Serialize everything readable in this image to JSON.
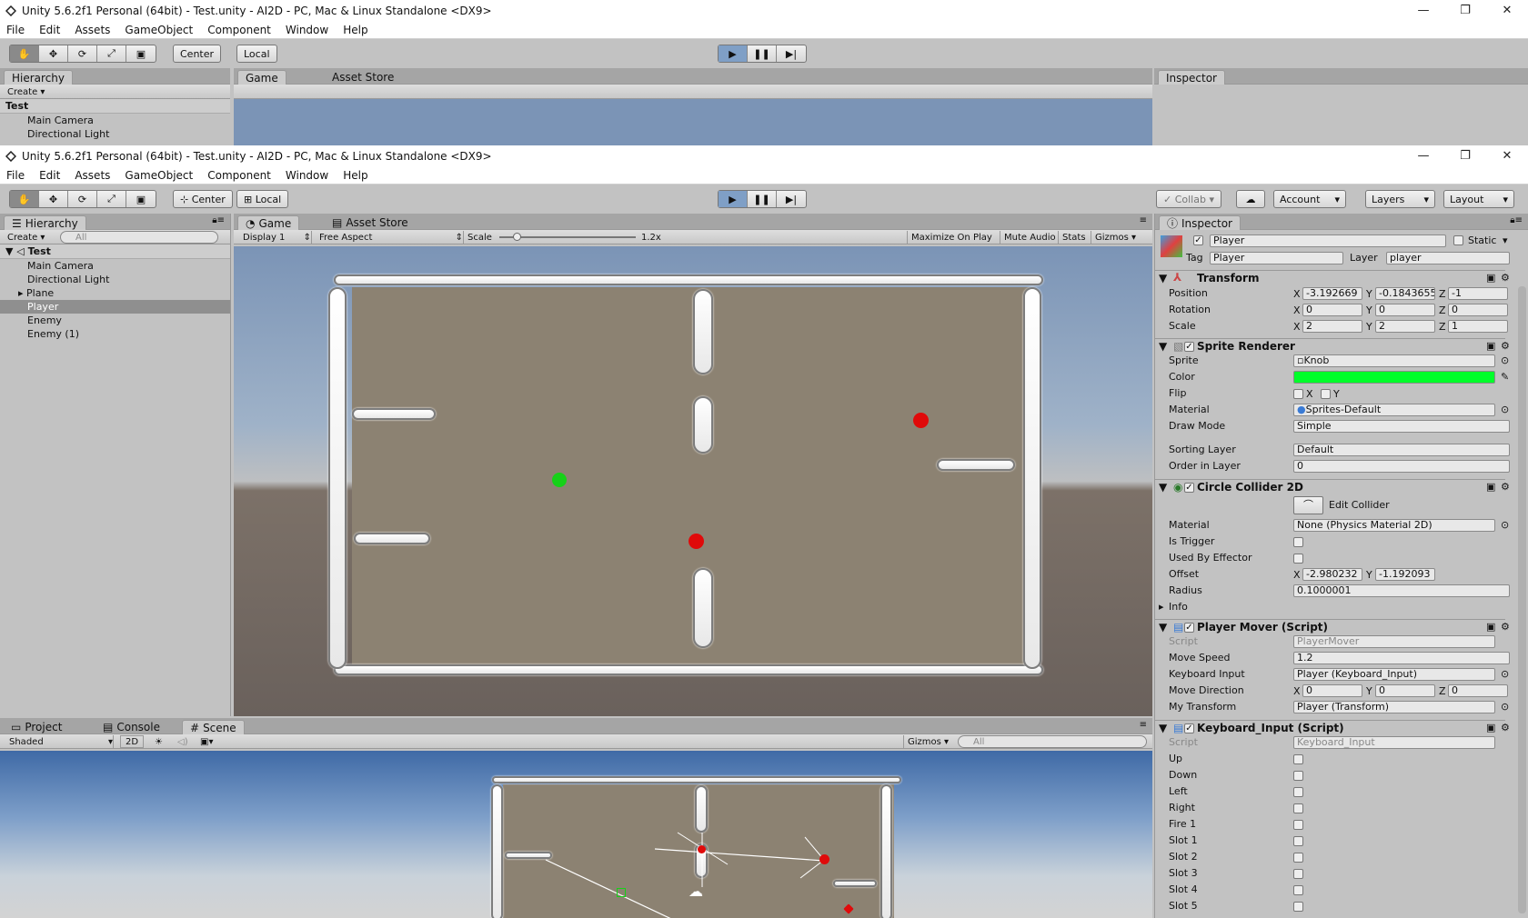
{
  "back_window": {
    "title": "Unity 5.6.2f1 Personal (64bit) - Test.unity - AI2D - PC, Mac & Linux Standalone <DX9>",
    "hierarchy": [
      "Main Camera",
      "Directional Light"
    ]
  },
  "window": {
    "title": "Unity 5.6.2f1 Personal (64bit) - Test.unity - AI2D - PC, Mac & Linux Standalone <DX9>",
    "controls": [
      "—",
      "❐",
      "✕"
    ]
  },
  "menu": [
    "File",
    "Edit",
    "Assets",
    "GameObject",
    "Component",
    "Window",
    "Help"
  ],
  "toolbar": {
    "center": "Center",
    "local": "Local",
    "collab": "Collab ▾",
    "account": "Account",
    "layers": "Layers",
    "layout": "Layout"
  },
  "hierarchy": {
    "tab": "Hierarchy",
    "create": "Create ▾",
    "search_placeholder": "All",
    "scene": "Test",
    "items": [
      "Main Camera",
      "Directional Light",
      "Plane",
      "Player",
      "Enemy",
      "Enemy (1)"
    ],
    "selected": "Player"
  },
  "game": {
    "tab_game": "Game",
    "tab_store": "Asset Store",
    "display": "Display 1",
    "aspect": "Free Aspect",
    "scale_label": "Scale",
    "scale_value": "1.2x",
    "scale_level": 0.1,
    "toggles": [
      "Maximize On Play",
      "Mute Audio",
      "Stats",
      "Gizmos ▾"
    ]
  },
  "bottom": {
    "tabs": [
      "Project",
      "Console",
      "Scene"
    ],
    "shading": "Shaded",
    "mode_2d": "2D",
    "gizmos": "Gizmos ▾",
    "search_placeholder": "All"
  },
  "inspector": {
    "tab": "Inspector",
    "object_name": "Player",
    "static_label": "Static",
    "tag_label": "Tag",
    "tag": "Player",
    "layer_label": "Layer",
    "layer": "player",
    "transform": {
      "title": "Transform",
      "position": [
        "-3.192669",
        "-0.1843655",
        "-1"
      ],
      "rotation": [
        "0",
        "0",
        "0"
      ],
      "scale": [
        "2",
        "2",
        "1"
      ],
      "labels": [
        "Position",
        "Rotation",
        "Scale"
      ]
    },
    "sprite_renderer": {
      "title": "Sprite Renderer",
      "sprite_label": "Sprite",
      "sprite": "Knob",
      "color_label": "Color",
      "color": "#00ff2a",
      "flip_label": "Flip",
      "material_label": "Material",
      "material": "Sprites-Default",
      "draw_mode_label": "Draw Mode",
      "draw_mode": "Simple",
      "sorting_layer_label": "Sorting Layer",
      "sorting_layer": "Default",
      "order_label": "Order in Layer",
      "order": "0"
    },
    "circle_collider": {
      "title": "Circle Collider 2D",
      "edit_collider": "Edit Collider",
      "material_label": "Material",
      "material": "None (Physics Material 2D)",
      "is_trigger": "Is Trigger",
      "used_by_effector": "Used By Effector",
      "offset_label": "Offset",
      "offset": [
        "-2.980232",
        "-1.192093"
      ],
      "radius_label": "Radius",
      "radius": "0.1000001",
      "info": "Info"
    },
    "player_mover": {
      "title": "Player Mover (Script)",
      "script_label": "Script",
      "script": "PlayerMover",
      "move_speed_label": "Move Speed",
      "move_speed": "1.2",
      "keyboard_input_label": "Keyboard Input",
      "keyboard_input": "Player (Keyboard_Input)",
      "move_direction_label": "Move Direction",
      "move_direction": [
        "0",
        "0",
        "0"
      ],
      "my_transform_label": "My Transform",
      "my_transform": "Player (Transform)"
    },
    "keyboard_input": {
      "title": "Keyboard_Input (Script)",
      "script_label": "Script",
      "script": "Keyboard_Input",
      "keys": [
        "Up",
        "Down",
        "Left",
        "Right",
        "Fire 1",
        "Slot 1",
        "Slot 2",
        "Slot 3",
        "Slot 4",
        "Slot 5"
      ]
    }
  },
  "colors": {
    "player": "#16d118",
    "enemy": "#e00a0a",
    "play_active": "#7f9fc6"
  }
}
